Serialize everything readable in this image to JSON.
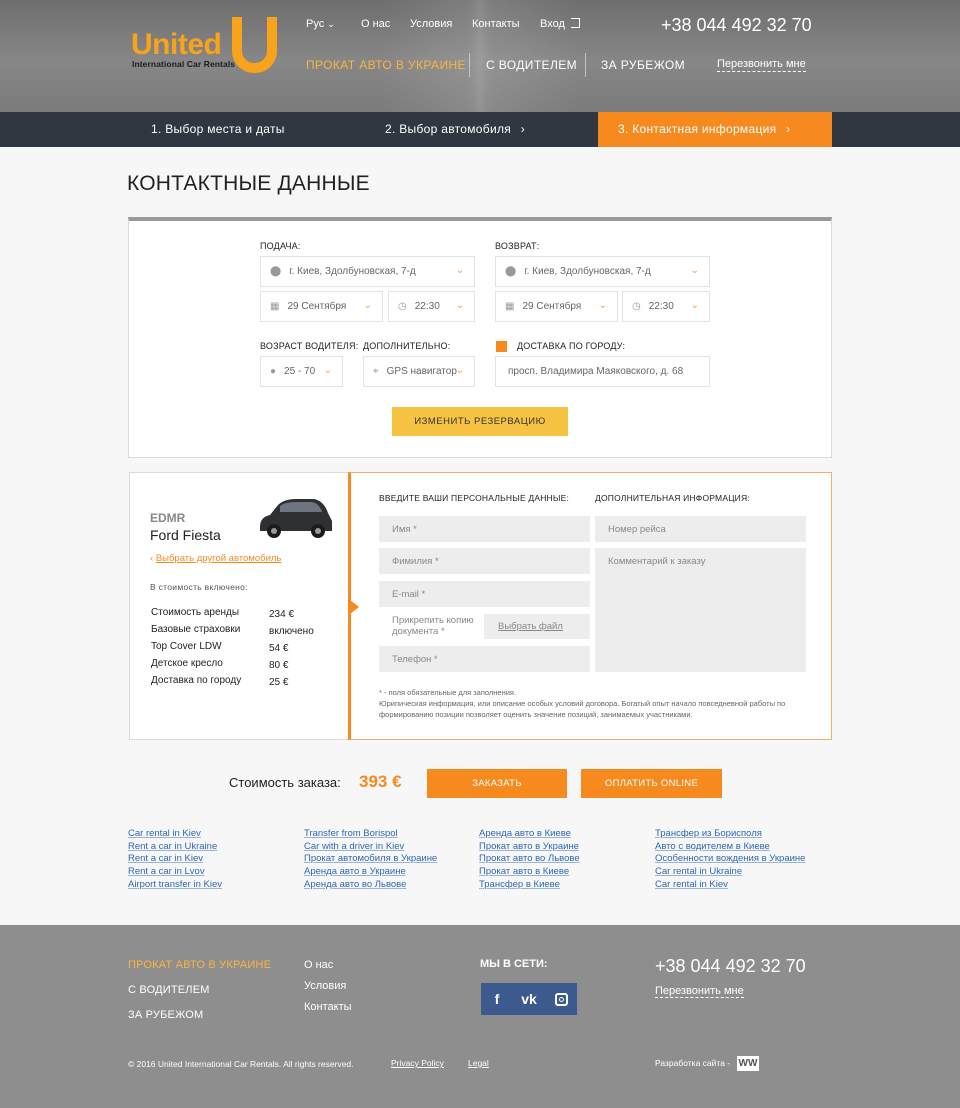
{
  "brand": {
    "word": "United",
    "sub": "International Car Rentals"
  },
  "top_menu": {
    "lang": "Рус",
    "about": "О нас",
    "terms": "Условия",
    "contacts": "Контакты",
    "login": "Вход"
  },
  "main_menu": {
    "rent_ukraine": "Прокат авто в Украине",
    "with_driver": "С водителем",
    "abroad": "За рубежом",
    "callback": "Перезвонить мне"
  },
  "phone": "+38 044 492 32 70",
  "steps": [
    "1. Выбор места и даты",
    "2. Выбор автомобиля",
    "3. Контактная информация"
  ],
  "page_title": "КОНТАКТНЫЕ ДАННЫЕ",
  "reservation": {
    "pickup_label": "Подача:",
    "return_label": "Возврат:",
    "pickup_address": "г. Киев, Здолбуновская, 7-д",
    "return_address": "г. Киев, Здолбуновская, 7-д",
    "pickup_date": "29 Сентября",
    "pickup_time": "22:30",
    "return_date": "29 Сентября",
    "return_time": "22:30",
    "age_label": "Возраст водителя:",
    "age_value": "25 - 70",
    "extra_label": "Дополнительно:",
    "extra_value": "GPS навигатор",
    "delivery_label": "Доставка по городу:",
    "delivery_address": "просп. Владимира Маяковского, д. 68",
    "change_button": "Изменить резервацию"
  },
  "car": {
    "code": "EDMR",
    "model": "Ford Fiesta",
    "change_link": "Выбрать другой автомобиль",
    "included_label": "В стоимость включено:",
    "items": [
      {
        "name": "Стоимость аренды",
        "value": "234 €"
      },
      {
        "name": "Базовые страховки",
        "value": "включено"
      },
      {
        "name": "Top Cover LDW",
        "value": "54 €"
      },
      {
        "name": "Детское кресло",
        "value": "80 €"
      },
      {
        "name": "Доставка по городу",
        "value": "25 €"
      }
    ]
  },
  "form": {
    "personal_label": "Введите ваши персональные данные:",
    "additional_label": "Дополнительная информация:",
    "name": "Имя *",
    "surname": "Фимилия *",
    "email": "E-mail *",
    "attach": "Прикрепить копию документа *",
    "choose_file": "Выбрать файл",
    "phone": "Телефон *",
    "flight": "Номер рейса",
    "comment": "Комментарий к заказу",
    "note1": "* - поля обязательные для заполнения.",
    "note2": "Юрипическая информация, или описание особых условий договора. Богатый опыт начало повседневной работы по формированию позиции позволяет оценить значение позиций, занимаемых участниками."
  },
  "total": {
    "label": "Стоимость заказа:",
    "price": "393 €",
    "order_button": "Заказать",
    "pay_button": "Оплатить online"
  },
  "seo_links": [
    [
      "Car rental in Kiev",
      "Rent a car in Ukraine",
      "Rent a car in Kiev",
      "Rent a car in Lvov",
      "Airport transfer in Kiev"
    ],
    [
      "Transfer from Borispol",
      "Car with a driver in Kiev",
      "Прокат автомобиля в Украине",
      "Аренда авто в Украине",
      "Аренда авто во Львове"
    ],
    [
      "Аренда авто в Киеве",
      "Прокат авто в Украине",
      "Прокат авто во Львове",
      "Прокат авто в Киеве",
      "Трансфер в Киеве"
    ],
    [
      "Трансфер из Борисполя",
      "Авто с водителем в Киеве",
      "Особенности вождения в Украине",
      "Car rental in Ukraine",
      "Car rental in Kiev"
    ]
  ],
  "footer": {
    "nav": [
      "Прокат авто в Украине",
      "С водителем",
      "За рубежом"
    ],
    "links": [
      "О нас",
      "Условия",
      "Контакты"
    ],
    "social_label": "Мы в сети:",
    "phone": "+38 044 492 32 70",
    "callback": "Перезвонить мне",
    "copyright": "© 2016 United International Car Rentals. All rights reserved.",
    "privacy": "Privacy Policy",
    "legal": "Legal",
    "dev": "Разработка сайта -"
  },
  "colors": {
    "accent": "#f68a1f",
    "logo": "#f9a21b",
    "steps_bg": "#313740",
    "footer_bg": "#8e8e8e",
    "link": "#2f67b5"
  }
}
